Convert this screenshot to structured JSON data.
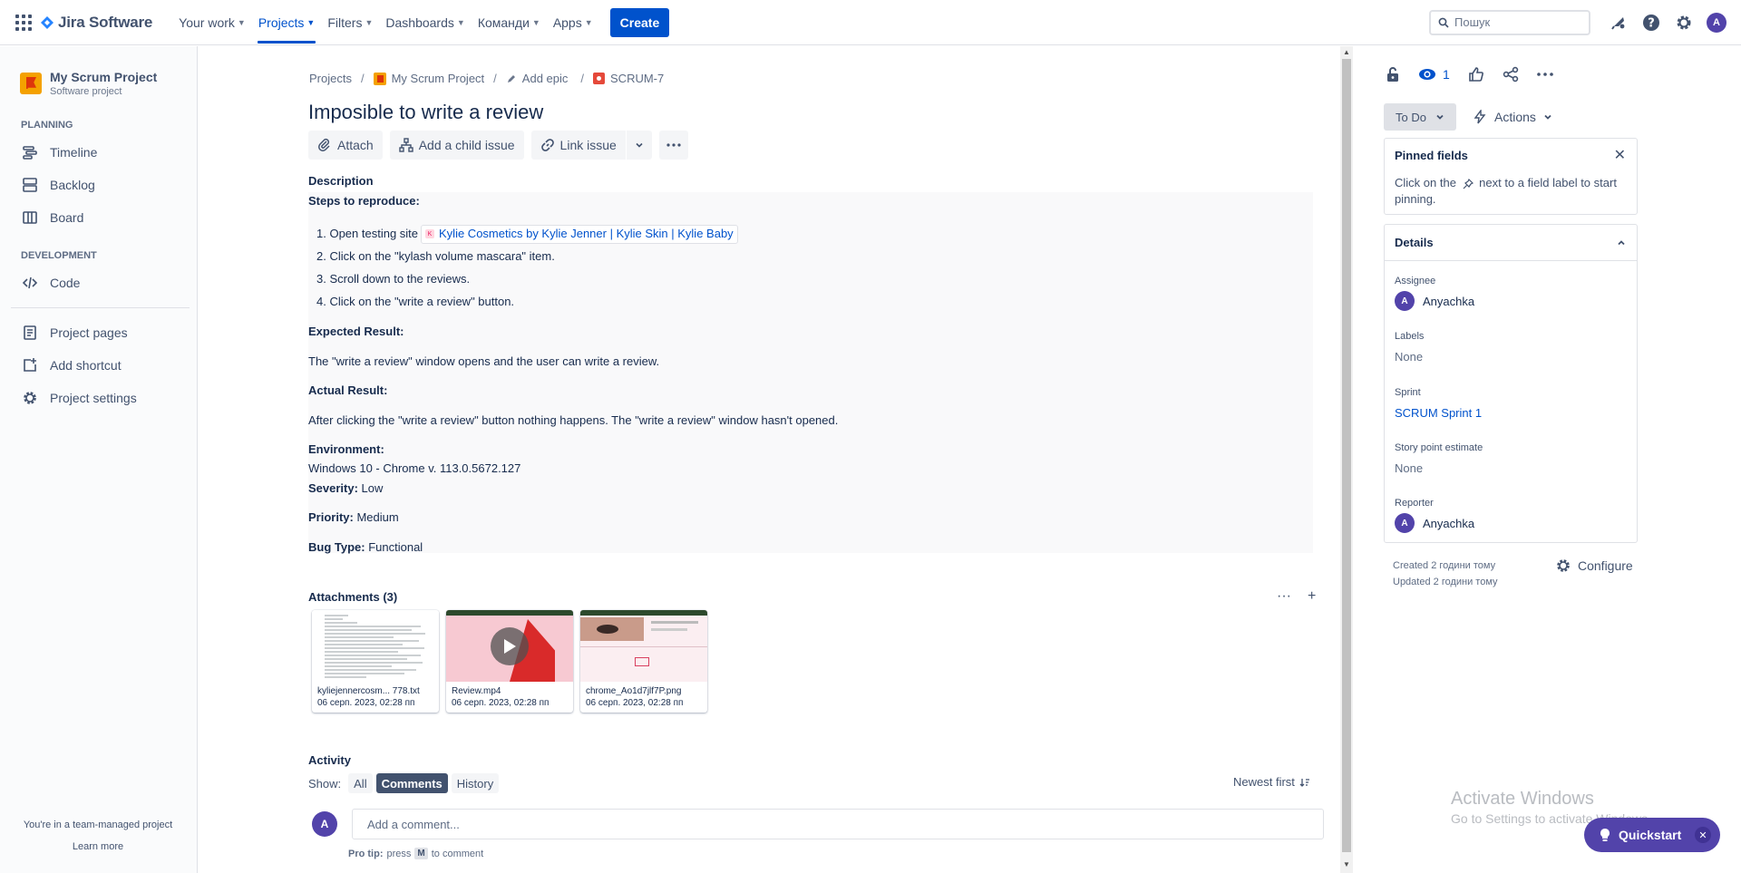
{
  "topnav": {
    "logo_text": "Jira Software",
    "items": [
      {
        "label": "Your work"
      },
      {
        "label": "Projects",
        "active": true
      },
      {
        "label": "Filters"
      },
      {
        "label": "Dashboards"
      },
      {
        "label": "Команди"
      },
      {
        "label": "Apps"
      }
    ],
    "create_label": "Create",
    "search_placeholder": "Пошук",
    "avatar_initial": "A"
  },
  "sidebar": {
    "project_name": "My Scrum Project",
    "project_type": "Software project",
    "planning_heading": "PLANNING",
    "planning_items": [
      "Timeline",
      "Backlog",
      "Board"
    ],
    "development_heading": "DEVELOPMENT",
    "development_items": [
      "Code"
    ],
    "other_items": [
      "Project pages",
      "Add shortcut",
      "Project settings"
    ],
    "footer_text": "You're in a team-managed project",
    "footer_link": "Learn more"
  },
  "breadcrumb": {
    "projects": "Projects",
    "project": "My Scrum Project",
    "epic": "Add epic",
    "issue_key": "SCRUM-7"
  },
  "issue": {
    "title": "Imposible to write a review",
    "toolbar": {
      "attach": "Attach",
      "add_child": "Add a child issue",
      "link_issue": "Link issue"
    },
    "description_label": "Description",
    "steps_heading": "Steps to reproduce:",
    "steps": {
      "s1_prefix": "1. Open testing site",
      "s1_link": "Kylie Cosmetics by Kylie Jenner | Kylie Skin | Kylie Baby",
      "s2": "2. Click on the \"kylash volume mascara\" item.",
      "s3": "3. Scroll down to the reviews.",
      "s4": "4. Click on the \"write a review\" button."
    },
    "expected_heading": "Expected Result:",
    "expected_text": "The \"write a review\" window opens and the user can write a review.",
    "actual_heading": "Actual Result:",
    "actual_text": "After clicking the \"write a review\" button nothing happens. The \"write a review\" window hasn't opened.",
    "environment_heading": "Environment:",
    "environment_text": "Windows 10 - Chrome v. 113.0.5672.127",
    "severity_label": "Severity:",
    "severity_value": "Low",
    "priority_label": "Priority:",
    "priority_value": "Medium",
    "bugtype_label": "Bug Type:",
    "bugtype_value": "Functional"
  },
  "attachments": {
    "title": "Attachments (3)",
    "items": [
      {
        "name": "kyliejennercosm... 778.txt",
        "date": "06 серп. 2023, 02:28 пп"
      },
      {
        "name": "Review.mp4",
        "date": "06 серп. 2023, 02:28 пп"
      },
      {
        "name": "chrome_Ao1d7jlf7P.png",
        "date": "06 серп. 2023, 02:28 пп"
      }
    ]
  },
  "activity": {
    "title": "Activity",
    "show_label": "Show:",
    "filters": [
      "All",
      "Comments",
      "History"
    ],
    "selected_filter": "Comments",
    "sort_label": "Newest first",
    "comment_placeholder": "Add a comment...",
    "protip_bold": "Pro tip:",
    "protip_press": "press",
    "protip_key": "M",
    "protip_tail": "to comment",
    "avatar_initial": "A"
  },
  "right_panel": {
    "watchers_count": "1",
    "status": "To Do",
    "actions_label": "Actions",
    "pinned_title": "Pinned fields",
    "pinned_text_1": "Click on the",
    "pinned_text_2": "next to a field label to start pinning.",
    "details_title": "Details",
    "fields": {
      "assignee_label": "Assignee",
      "assignee_value": "Anyachka",
      "labels_label": "Labels",
      "labels_value": "None",
      "sprint_label": "Sprint",
      "sprint_value": "SCRUM Sprint 1",
      "story_points_label": "Story point estimate",
      "story_points_value": "None",
      "reporter_label": "Reporter",
      "reporter_value": "Anyachka",
      "avatar_initial": "A"
    },
    "created": "Created 2 години тому",
    "updated": "Updated 2 години тому",
    "configure_label": "Configure"
  },
  "overlay": {
    "activate_title": "Activate Windows",
    "activate_sub": "Go to Settings to activate Windows.",
    "quickstart_label": "Quickstart"
  },
  "colors": {
    "brand": "#0052cc",
    "avatar": "#5243aa",
    "quickstart": "#5243aa"
  }
}
